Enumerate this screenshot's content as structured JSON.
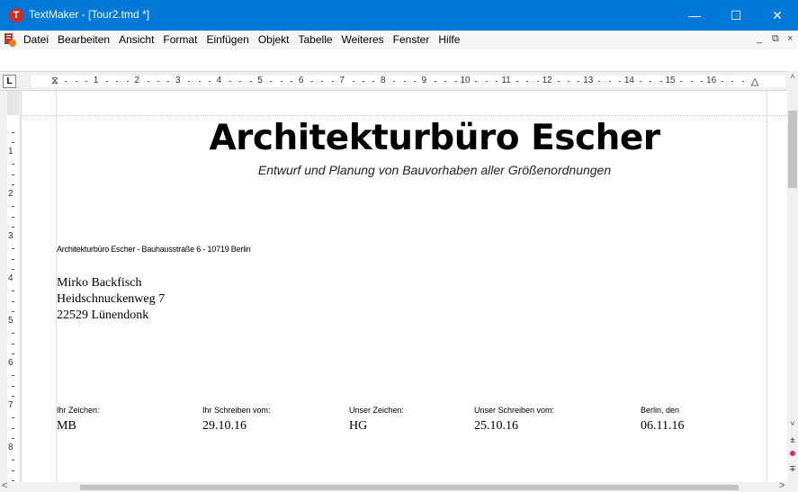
{
  "window": {
    "title": "TextMaker - [Tour2.tmd *]",
    "app_icon_letter": "T",
    "minimize_glyph": "—",
    "maximize_glyph": "☐",
    "close_glyph": "✕",
    "accent_color": "#0078d7"
  },
  "menu": {
    "items": [
      "Datei",
      "Bearbeiten",
      "Ansicht",
      "Format",
      "Einfügen",
      "Objekt",
      "Tabelle",
      "Weiteres",
      "Fenster",
      "Hilfe"
    ],
    "mdi_minimize": "_",
    "mdi_restore": "⧉",
    "mdi_close": "×"
  },
  "ruler": {
    "tab_selector": "L",
    "h_labels": [
      "1",
      "2",
      "3",
      "4",
      "5",
      "6",
      "7",
      "8",
      "9",
      "10",
      "11",
      "12",
      "13",
      "14",
      "15",
      "16"
    ],
    "v_labels": [
      "1",
      "2",
      "3",
      "4",
      "5",
      "6",
      "7",
      "8"
    ]
  },
  "document": {
    "title": "Architekturbüro Escher",
    "subtitle": "Entwurf und Planung von Bauvorhaben aller Größenordnungen",
    "sender_line": "Architekturbüro Escher - Bauhausstraße 6 - 10719 Berlin",
    "recipient": {
      "name": "Mirko Backfisch",
      "street": "Heidschnuckenweg 7",
      "city": "22529 Lünendonk"
    },
    "references": [
      {
        "label": "Ihr Zeichen:",
        "value": "MB"
      },
      {
        "label": "Ihr Schreiben vom:",
        "value": "29.10.16"
      },
      {
        "label": "Unser Zeichen:",
        "value": "HG"
      },
      {
        "label": "Unser Schreiben vom:",
        "value": "25.10.16"
      },
      {
        "label": "Berlin, den",
        "value": "06.11.16"
      }
    ]
  },
  "scrollbars": {
    "up_glyph": "˄",
    "down_glyph": "˅",
    "left_glyph": "<",
    "right_glyph": ">",
    "prev_page_glyph": "±",
    "next_page_glyph": "∓"
  }
}
